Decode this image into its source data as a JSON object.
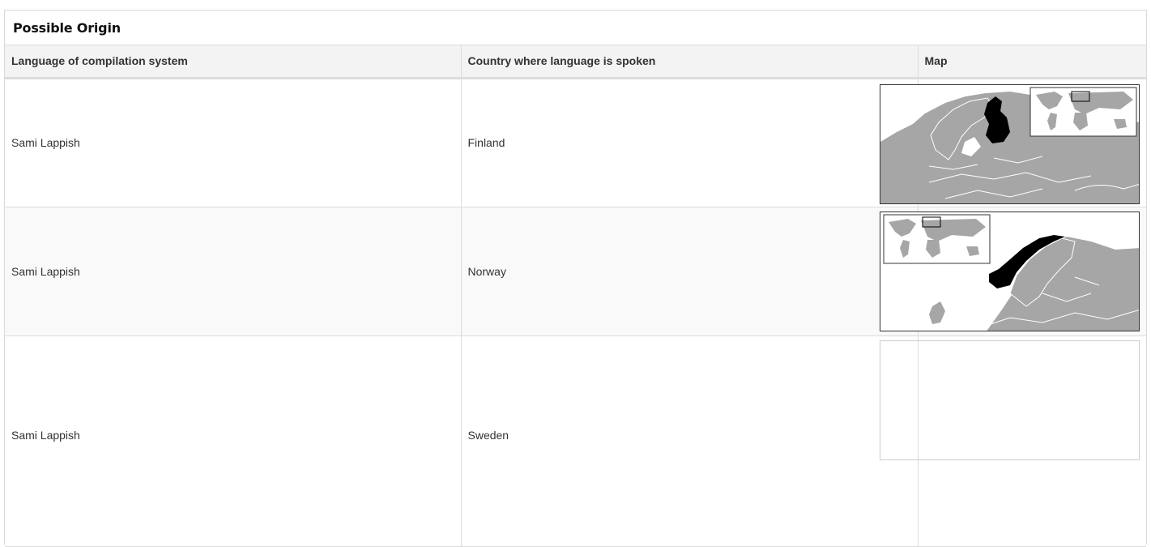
{
  "panel": {
    "title": "Possible Origin"
  },
  "table": {
    "headers": [
      "Language of compilation system",
      "Country where language is spoken",
      "Map"
    ],
    "rows": [
      {
        "language": "Sami Lappish",
        "country": "Finland",
        "map_icon": "finland-locator-map"
      },
      {
        "language": "Sami Lappish",
        "country": "Norway",
        "map_icon": "norway-locator-map"
      },
      {
        "language": "Sami Lappish",
        "country": "Sweden",
        "map_icon": "sweden-map-placeholder"
      }
    ]
  },
  "colors": {
    "land": "#a6a6a6",
    "highlight": "#000000",
    "header_bg": "#f3f3f3",
    "border": "#dcdcdc"
  }
}
